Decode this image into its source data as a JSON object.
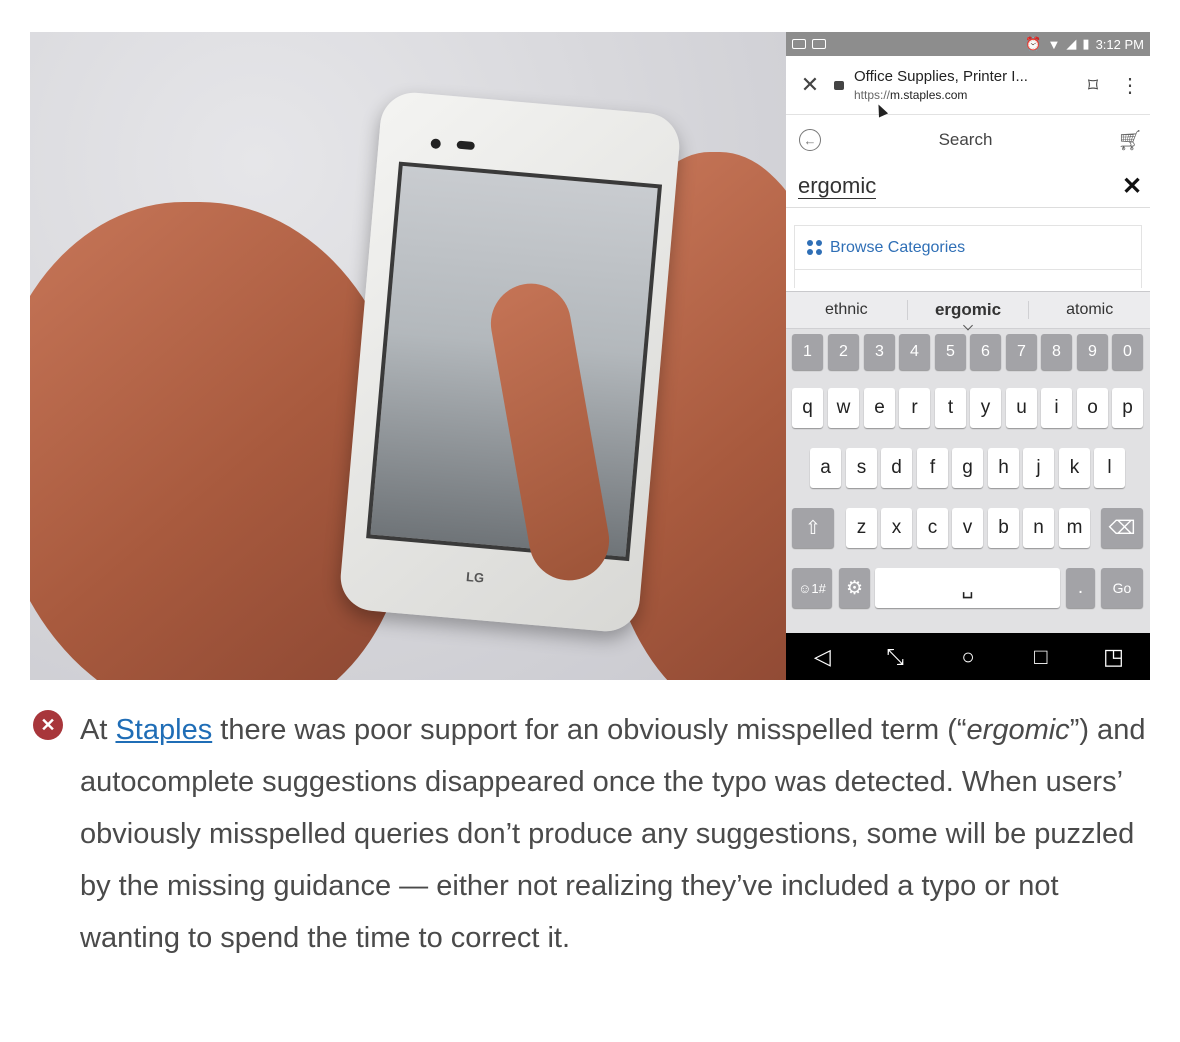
{
  "statusbar": {
    "time": "3:12 PM"
  },
  "browser": {
    "page_title": "Office Supplies, Printer I...",
    "url_scheme": "https://",
    "url_host": "m.staples.com"
  },
  "search": {
    "label": "Search",
    "query": "ergomic",
    "browse_label": "Browse Categories"
  },
  "keyboard": {
    "suggestions": [
      "ethnic",
      "ergomic",
      "atomic"
    ],
    "number_row": [
      "1",
      "2",
      "3",
      "4",
      "5",
      "6",
      "7",
      "8",
      "9",
      "0"
    ],
    "row1": [
      "q",
      "w",
      "e",
      "r",
      "t",
      "y",
      "u",
      "i",
      "o",
      "p"
    ],
    "row2": [
      "a",
      "s",
      "d",
      "f",
      "g",
      "h",
      "j",
      "k",
      "l"
    ],
    "row3": [
      "z",
      "x",
      "c",
      "v",
      "b",
      "n",
      "m"
    ],
    "symbols_key": "☺1#",
    "period_key": ".",
    "go_key": "Go"
  },
  "photo": {
    "phone_brand": "LG"
  },
  "caption": {
    "prefix": "At ",
    "link": "Staples",
    "text1": " there was poor support for an obviously misspelled term (“",
    "term": "ergomic",
    "text2": "”) and autocomplete suggestions disappeared once the typo was detected. When users’ obviously misspelled queries don’t produce any suggestions, some will be puzzled by the missing guidance — either not realizing they’ve included a typo or not wanting to spend the time to correct it."
  }
}
